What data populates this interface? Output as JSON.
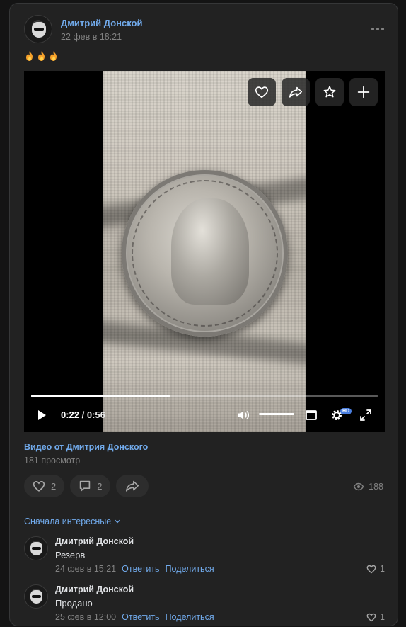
{
  "post": {
    "author": "Дмитрий Донской",
    "date": "22 фев в 18:21",
    "text_emojis": [
      "fire-emoji",
      "fire-emoji",
      "fire-emoji"
    ],
    "more_icon": "more-horizontal-icon"
  },
  "video": {
    "time_current": "0:22",
    "time_separator": " / ",
    "time_total": "0:56",
    "progress": 0.4,
    "quality_badge": "HD",
    "overlay_icons": [
      "heart-icon",
      "share-icon",
      "star-icon",
      "plus-icon"
    ],
    "controls_icons": [
      "play-icon",
      "volume-icon",
      "miniplayer-icon",
      "settings-icon",
      "fullscreen-icon"
    ],
    "title": "Видео от Дмитрия Донского",
    "views": "181 просмотр"
  },
  "actions": {
    "likes": "2",
    "comments": "2",
    "views": "188"
  },
  "comments_section": {
    "sort_label": "Сначала интересные",
    "items": [
      {
        "author": "Дмитрий Донской",
        "text": "Резерв",
        "date": "24 фев в 15:21",
        "reply_label": "Ответить",
        "share_label": "Поделиться",
        "likes": "1"
      },
      {
        "author": "Дмитрий Донской",
        "text": "Продано",
        "date": "25 фев в 12:00",
        "reply_label": "Ответить",
        "share_label": "Поделиться",
        "likes": "1"
      }
    ]
  },
  "colors": {
    "background": "#141414",
    "card": "#222222",
    "accent_link": "#71aaeb",
    "muted_text": "#828282"
  }
}
